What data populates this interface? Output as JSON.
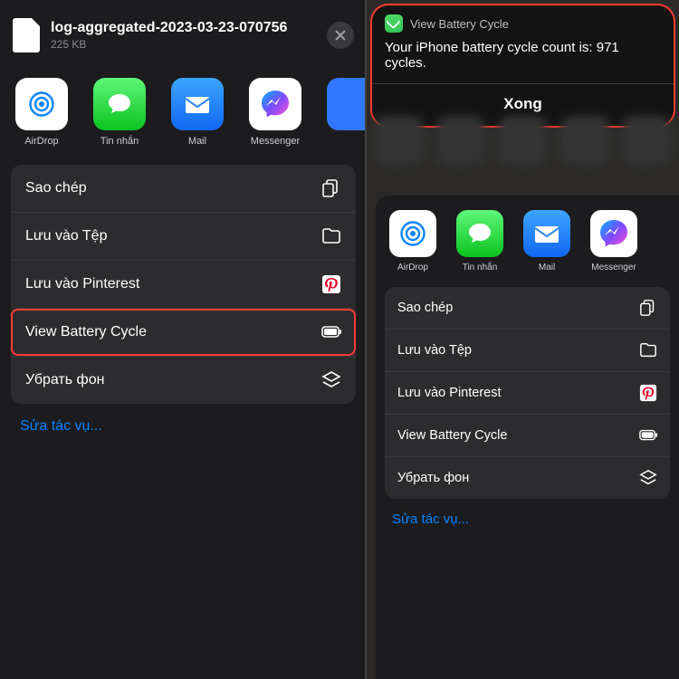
{
  "left": {
    "file": {
      "name": "log-aggregated-2023-03-23-070756",
      "size": "225 KB"
    },
    "share": [
      {
        "id": "airdrop",
        "label": "AirDrop"
      },
      {
        "id": "messages",
        "label": "Tin nhắn"
      },
      {
        "id": "mail",
        "label": "Mail"
      },
      {
        "id": "messenger",
        "label": "Messenger"
      },
      {
        "id": "extra",
        "label": ""
      }
    ],
    "actions": [
      {
        "label": "Sao chép",
        "icon": "copy"
      },
      {
        "label": "Lưu vào Tệp",
        "icon": "folder"
      },
      {
        "label": "Lưu vào Pinterest",
        "icon": "pinterest"
      },
      {
        "label": "View Battery Cycle",
        "icon": "battery",
        "highlight": true
      },
      {
        "label": "Убрать фон",
        "icon": "layers"
      }
    ],
    "edit": "Sửa tác vụ..."
  },
  "right": {
    "notif": {
      "app": "View Battery Cycle",
      "body": "Your iPhone battery cycle count is: 971 cycles.",
      "done": "Xong"
    },
    "share": [
      {
        "id": "airdrop",
        "label": "AirDrop"
      },
      {
        "id": "messages",
        "label": "Tin nhắn"
      },
      {
        "id": "mail",
        "label": "Mail"
      },
      {
        "id": "messenger",
        "label": "Messenger"
      }
    ],
    "actions": [
      {
        "label": "Sao chép",
        "icon": "copy"
      },
      {
        "label": "Lưu vào Tệp",
        "icon": "folder"
      },
      {
        "label": "Lưu vào Pinterest",
        "icon": "pinterest"
      },
      {
        "label": "View Battery Cycle",
        "icon": "battery"
      },
      {
        "label": "Убрать фон",
        "icon": "layers"
      }
    ],
    "edit": "Sửa tác vụ..."
  }
}
